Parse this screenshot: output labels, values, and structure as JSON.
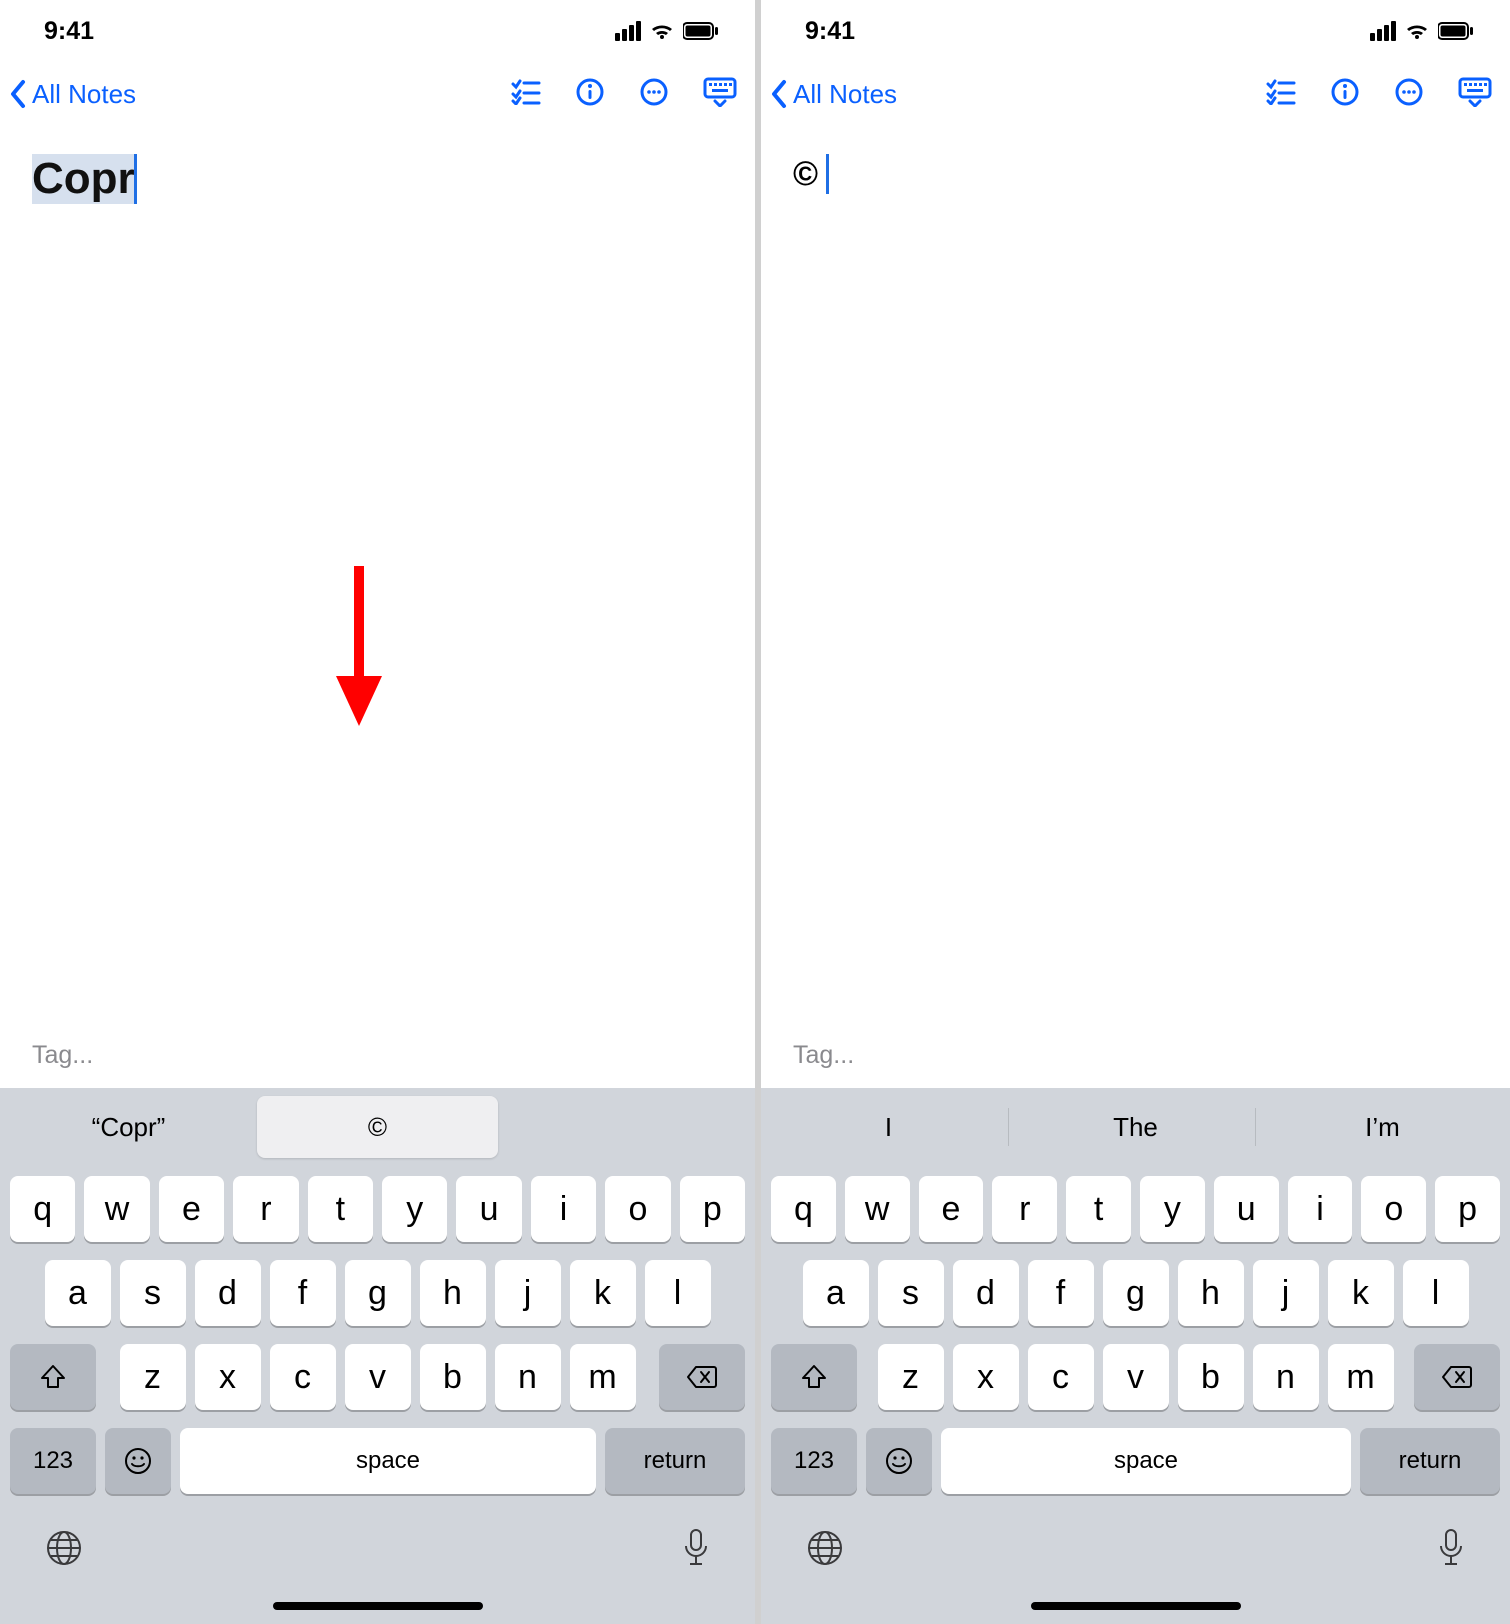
{
  "left": {
    "status": {
      "time": "9:41"
    },
    "nav": {
      "back_label": "All Notes"
    },
    "content": {
      "title_text": "Copr",
      "tag_placeholder": "Tag..."
    },
    "suggestions": {
      "s1": "“Copr”",
      "s2": "©"
    },
    "keyboard": {
      "row1": [
        "q",
        "w",
        "e",
        "r",
        "t",
        "y",
        "u",
        "i",
        "o",
        "p"
      ],
      "row2": [
        "a",
        "s",
        "d",
        "f",
        "g",
        "h",
        "j",
        "k",
        "l"
      ],
      "row3": [
        "z",
        "x",
        "c",
        "v",
        "b",
        "n",
        "m"
      ],
      "k123": "123",
      "space": "space",
      "return": "return"
    }
  },
  "right": {
    "status": {
      "time": "9:41"
    },
    "nav": {
      "back_label": "All Notes"
    },
    "content": {
      "copyright_symbol": "©",
      "tag_placeholder": "Tag..."
    },
    "suggestions": {
      "s1": "I",
      "s2": "The",
      "s3": "I’m"
    },
    "keyboard": {
      "row1": [
        "q",
        "w",
        "e",
        "r",
        "t",
        "y",
        "u",
        "i",
        "o",
        "p"
      ],
      "row2": [
        "a",
        "s",
        "d",
        "f",
        "g",
        "h",
        "j",
        "k",
        "l"
      ],
      "row3": [
        "z",
        "x",
        "c",
        "v",
        "b",
        "n",
        "m"
      ],
      "k123": "123",
      "space": "space",
      "return": "return"
    }
  }
}
